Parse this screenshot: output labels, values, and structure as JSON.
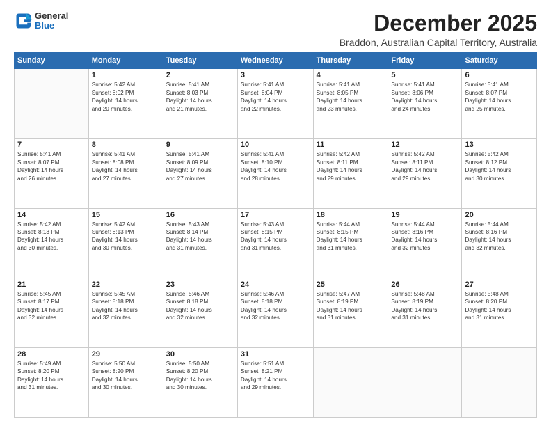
{
  "logo": {
    "line1": "General",
    "line2": "Blue"
  },
  "header": {
    "title": "December 2025",
    "subtitle": "Braddon, Australian Capital Territory, Australia"
  },
  "days_of_week": [
    "Sunday",
    "Monday",
    "Tuesday",
    "Wednesday",
    "Thursday",
    "Friday",
    "Saturday"
  ],
  "weeks": [
    [
      {
        "day": "",
        "info": ""
      },
      {
        "day": "1",
        "info": "Sunrise: 5:42 AM\nSunset: 8:02 PM\nDaylight: 14 hours\nand 20 minutes."
      },
      {
        "day": "2",
        "info": "Sunrise: 5:41 AM\nSunset: 8:03 PM\nDaylight: 14 hours\nand 21 minutes."
      },
      {
        "day": "3",
        "info": "Sunrise: 5:41 AM\nSunset: 8:04 PM\nDaylight: 14 hours\nand 22 minutes."
      },
      {
        "day": "4",
        "info": "Sunrise: 5:41 AM\nSunset: 8:05 PM\nDaylight: 14 hours\nand 23 minutes."
      },
      {
        "day": "5",
        "info": "Sunrise: 5:41 AM\nSunset: 8:06 PM\nDaylight: 14 hours\nand 24 minutes."
      },
      {
        "day": "6",
        "info": "Sunrise: 5:41 AM\nSunset: 8:07 PM\nDaylight: 14 hours\nand 25 minutes."
      }
    ],
    [
      {
        "day": "7",
        "info": "Sunrise: 5:41 AM\nSunset: 8:07 PM\nDaylight: 14 hours\nand 26 minutes."
      },
      {
        "day": "8",
        "info": "Sunrise: 5:41 AM\nSunset: 8:08 PM\nDaylight: 14 hours\nand 27 minutes."
      },
      {
        "day": "9",
        "info": "Sunrise: 5:41 AM\nSunset: 8:09 PM\nDaylight: 14 hours\nand 27 minutes."
      },
      {
        "day": "10",
        "info": "Sunrise: 5:41 AM\nSunset: 8:10 PM\nDaylight: 14 hours\nand 28 minutes."
      },
      {
        "day": "11",
        "info": "Sunrise: 5:42 AM\nSunset: 8:11 PM\nDaylight: 14 hours\nand 29 minutes."
      },
      {
        "day": "12",
        "info": "Sunrise: 5:42 AM\nSunset: 8:11 PM\nDaylight: 14 hours\nand 29 minutes."
      },
      {
        "day": "13",
        "info": "Sunrise: 5:42 AM\nSunset: 8:12 PM\nDaylight: 14 hours\nand 30 minutes."
      }
    ],
    [
      {
        "day": "14",
        "info": "Sunrise: 5:42 AM\nSunset: 8:13 PM\nDaylight: 14 hours\nand 30 minutes."
      },
      {
        "day": "15",
        "info": "Sunrise: 5:42 AM\nSunset: 8:13 PM\nDaylight: 14 hours\nand 30 minutes."
      },
      {
        "day": "16",
        "info": "Sunrise: 5:43 AM\nSunset: 8:14 PM\nDaylight: 14 hours\nand 31 minutes."
      },
      {
        "day": "17",
        "info": "Sunrise: 5:43 AM\nSunset: 8:15 PM\nDaylight: 14 hours\nand 31 minutes."
      },
      {
        "day": "18",
        "info": "Sunrise: 5:44 AM\nSunset: 8:15 PM\nDaylight: 14 hours\nand 31 minutes."
      },
      {
        "day": "19",
        "info": "Sunrise: 5:44 AM\nSunset: 8:16 PM\nDaylight: 14 hours\nand 32 minutes."
      },
      {
        "day": "20",
        "info": "Sunrise: 5:44 AM\nSunset: 8:16 PM\nDaylight: 14 hours\nand 32 minutes."
      }
    ],
    [
      {
        "day": "21",
        "info": "Sunrise: 5:45 AM\nSunset: 8:17 PM\nDaylight: 14 hours\nand 32 minutes."
      },
      {
        "day": "22",
        "info": "Sunrise: 5:45 AM\nSunset: 8:18 PM\nDaylight: 14 hours\nand 32 minutes."
      },
      {
        "day": "23",
        "info": "Sunrise: 5:46 AM\nSunset: 8:18 PM\nDaylight: 14 hours\nand 32 minutes."
      },
      {
        "day": "24",
        "info": "Sunrise: 5:46 AM\nSunset: 8:18 PM\nDaylight: 14 hours\nand 32 minutes."
      },
      {
        "day": "25",
        "info": "Sunrise: 5:47 AM\nSunset: 8:19 PM\nDaylight: 14 hours\nand 31 minutes."
      },
      {
        "day": "26",
        "info": "Sunrise: 5:48 AM\nSunset: 8:19 PM\nDaylight: 14 hours\nand 31 minutes."
      },
      {
        "day": "27",
        "info": "Sunrise: 5:48 AM\nSunset: 8:20 PM\nDaylight: 14 hours\nand 31 minutes."
      }
    ],
    [
      {
        "day": "28",
        "info": "Sunrise: 5:49 AM\nSunset: 8:20 PM\nDaylight: 14 hours\nand 31 minutes."
      },
      {
        "day": "29",
        "info": "Sunrise: 5:50 AM\nSunset: 8:20 PM\nDaylight: 14 hours\nand 30 minutes."
      },
      {
        "day": "30",
        "info": "Sunrise: 5:50 AM\nSunset: 8:20 PM\nDaylight: 14 hours\nand 30 minutes."
      },
      {
        "day": "31",
        "info": "Sunrise: 5:51 AM\nSunset: 8:21 PM\nDaylight: 14 hours\nand 29 minutes."
      },
      {
        "day": "",
        "info": ""
      },
      {
        "day": "",
        "info": ""
      },
      {
        "day": "",
        "info": ""
      }
    ]
  ]
}
